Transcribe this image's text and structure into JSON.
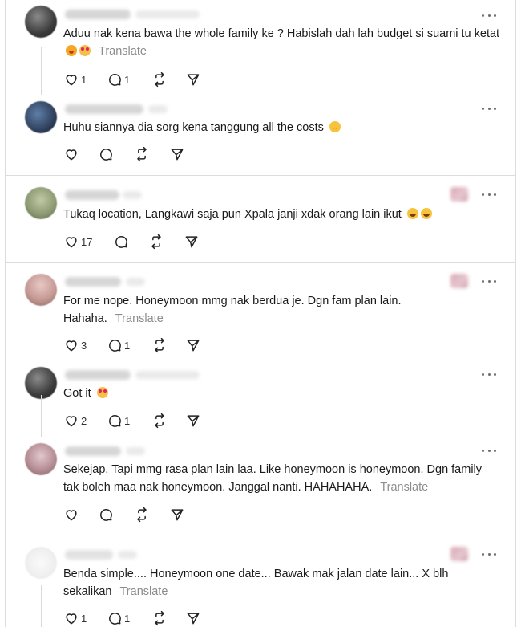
{
  "posts": [
    {
      "text": "Aduu nak kena bawa the whole family ke ? Habislah dah lah budget si suami tu ketat",
      "translate": "Translate",
      "likes": "1",
      "replies": "1"
    },
    {
      "text": "Huhu siannya dia sorg kena tanggung all the costs",
      "likes": "",
      "replies": ""
    },
    {
      "text": "Tukaq location, Langkawi saja pun Xpala janji xdak orang lain ikut",
      "likes": "17",
      "replies": ""
    },
    {
      "text": "For me nope. Honeymoon mmg nak berdua je. Dgn fam plan lain. Hahaha.",
      "translate": "Translate",
      "likes": "3",
      "replies": "1"
    },
    {
      "text": "Got it",
      "likes": "2",
      "replies": "1"
    },
    {
      "text": "Sekejap. Tapi mmg rasa plan lain laa. Like honeymoon is honeymoon. Dgn family tak boleh maa nak honeymoon. Janggal nanti. HAHAHAHA.",
      "translate": "Translate",
      "likes": "",
      "replies": ""
    },
    {
      "text": "Benda simple.... Honeymoon one date... Bawak mak jalan date lain... X blh sekalikan",
      "translate": "Translate",
      "likes": "1",
      "replies": "1"
    }
  ],
  "icons": [
    "heart-icon",
    "comment-icon",
    "repost-icon",
    "share-icon",
    "more-icon"
  ]
}
